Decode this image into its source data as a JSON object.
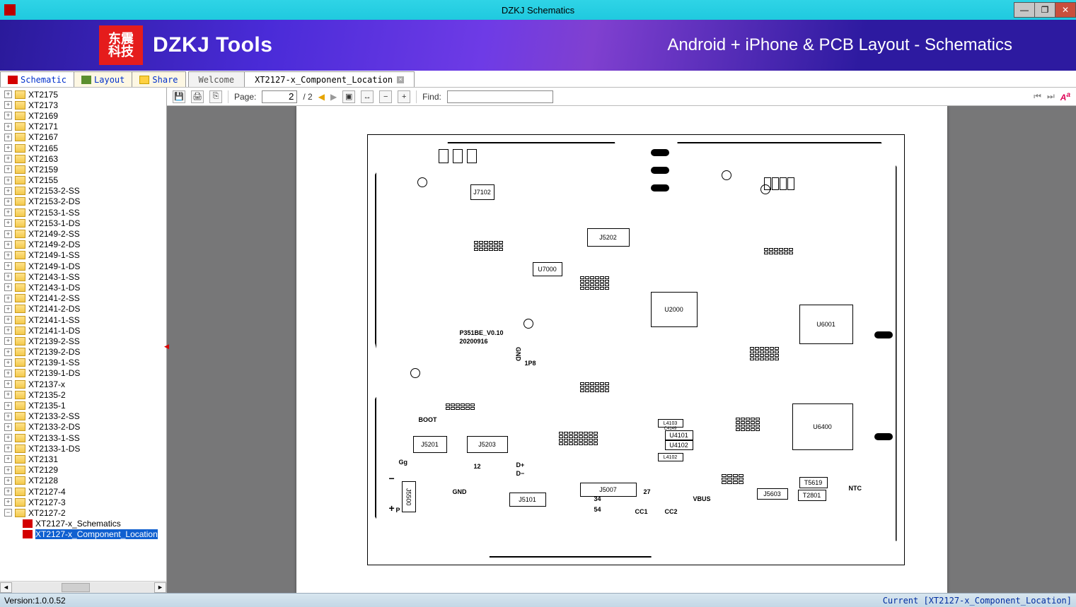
{
  "window": {
    "title": "DZKJ Schematics",
    "controls": {
      "min": "—",
      "max": "❐",
      "close": "✕"
    }
  },
  "banner": {
    "logo_top": "东震",
    "logo_bottom": "科技",
    "brand": "DZKJ Tools",
    "tagline": "Android + iPhone & PCB Layout - Schematics"
  },
  "side_tabs": [
    {
      "id": "schematic",
      "label": "Schematic",
      "icon": "pdf",
      "active": true
    },
    {
      "id": "layout",
      "label": "Layout",
      "icon": "pads",
      "active": false
    },
    {
      "id": "share",
      "label": "Share",
      "icon": "share",
      "active": false
    }
  ],
  "doc_tabs": [
    {
      "id": "welcome",
      "label": "Welcome",
      "active": false,
      "closable": false
    },
    {
      "id": "xt2127",
      "label": "XT2127-x_Component_Location",
      "active": true,
      "closable": true
    }
  ],
  "tree": {
    "items": [
      "XT2175",
      "XT2173",
      "XT2169",
      "XT2171",
      "XT2167",
      "XT2165",
      "XT2163",
      "XT2159",
      "XT2155",
      "XT2153-2-SS",
      "XT2153-2-DS",
      "XT2153-1-SS",
      "XT2153-1-DS",
      "XT2149-2-SS",
      "XT2149-2-DS",
      "XT2149-1-SS",
      "XT2149-1-DS",
      "XT2143-1-SS",
      "XT2143-1-DS",
      "XT2141-2-SS",
      "XT2141-2-DS",
      "XT2141-1-SS",
      "XT2141-1-DS",
      "XT2139-2-SS",
      "XT2139-2-DS",
      "XT2139-1-SS",
      "XT2139-1-DS",
      "XT2137-x",
      "XT2135-2",
      "XT2135-1",
      "XT2133-2-SS",
      "XT2133-2-DS",
      "XT2133-1-SS",
      "XT2133-1-DS",
      "XT2131",
      "XT2129",
      "XT2128",
      "XT2127-4",
      "XT2127-3"
    ],
    "expanded_item": "XT2127-2",
    "children": [
      {
        "label": "XT2127-x_Schematics",
        "selected": false
      },
      {
        "label": "XT2127-x_Component_Location",
        "selected": true
      }
    ]
  },
  "toolbar": {
    "page_label": "Page:",
    "page_current": "2",
    "page_total": "/ 2",
    "find_label": "Find:",
    "find_value": ""
  },
  "pcb": {
    "board_rev": "P351BE_V0.10",
    "board_date": "20200916",
    "labels": {
      "gnd1": "GND",
      "p8": "1P8",
      "boot": "BOOT",
      "gg": "Gg",
      "pminus": "−",
      "pplus": "+",
      "p": "P",
      "gnd2": "GND",
      "dplus": "D+",
      "dminus": "D−",
      "cc1": "CC1",
      "cc2": "CC2",
      "vbus": "VBUS",
      "ntc": "NTC"
    },
    "chips": {
      "j7102": "J7102",
      "j5202": "J5202",
      "u7000": "U7000",
      "u2000": "U2000",
      "u6001": "U6001",
      "u6400": "U6400",
      "j5201": "J5201",
      "j5203": "J5203",
      "j5500": "J5500",
      "j5101": "J5101",
      "j5007": "J5007",
      "u4101": "U4101",
      "u4102": "U4102",
      "l4102": "L4102",
      "l4103": "L4103",
      "c4149": "C4149",
      "t5619": "T5619",
      "j5603": "J5603",
      "t2801": "T2801",
      "nums": {
        "n12": "12",
        "n34": "34",
        "n27": "27",
        "n54": "54"
      }
    }
  },
  "status": {
    "version": "Version:1.0.0.52",
    "current": "Current [XT2127-x_Component_Location]"
  }
}
